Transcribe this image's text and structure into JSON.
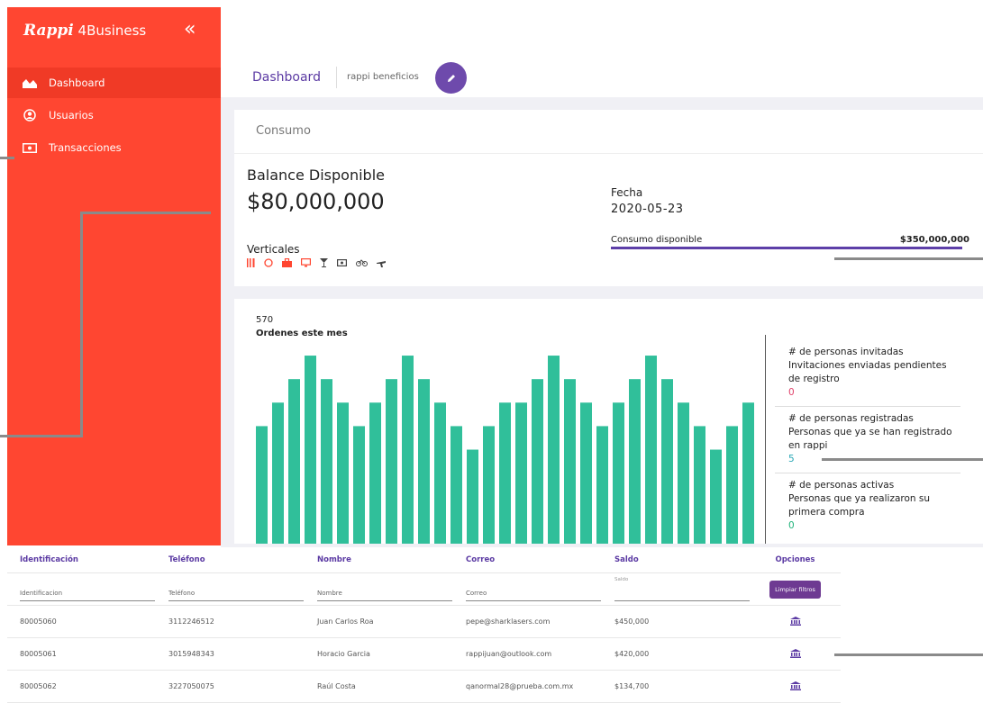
{
  "app": {
    "brand_name": "Rappi",
    "brand_suffix": "4Business",
    "collapse_icon": "double-chevron-left-icon"
  },
  "colors": {
    "sidebar": "#ff4631",
    "accent": "#5b3aa3",
    "bar": "#30bf9a",
    "pink": "#e0426a",
    "teal": "#2aa7b5",
    "green": "#21b37a"
  },
  "sidebar": {
    "items": [
      {
        "label": "Dashboard",
        "icon": "area-chart-icon",
        "active": true
      },
      {
        "label": "Usuarios",
        "icon": "user-circle-icon",
        "active": false
      },
      {
        "label": "Transacciones",
        "icon": "money-bill-icon",
        "active": false
      }
    ]
  },
  "header": {
    "title": "Dashboard",
    "subtitle": "rappi beneficios",
    "edit_icon": "pencil-icon"
  },
  "consumo": {
    "title": "Consumo",
    "balance_label": "Balance Disponible",
    "balance_value": "$80,000,000",
    "verticales_label": "Verticales",
    "vertical_icons": [
      "utensils-icon",
      "bubble-icon",
      "briefcase-icon",
      "monitor-icon",
      "cocktail-icon",
      "money-bill-icon",
      "bicycle-icon",
      "plane-icon"
    ],
    "fecha_label": "Fecha",
    "fecha_value": "2020-05-23",
    "consumo_label": "Consumo disponible",
    "consumo_value": "$350,000,000",
    "consumo_fill": 0.98
  },
  "orders": {
    "count": "570",
    "label": "Ordenes este mes"
  },
  "chart_data": {
    "type": "bar",
    "values": [
      5,
      6,
      7,
      8,
      7,
      6,
      5,
      6,
      7,
      8,
      7,
      6,
      5,
      4,
      5,
      6,
      6,
      7,
      8,
      7,
      6,
      5,
      6,
      7,
      8,
      7,
      6,
      5,
      4,
      5,
      6
    ],
    "ylim": [
      0,
      8.5
    ]
  },
  "stats": [
    {
      "title": "# de personas invitadas",
      "desc": "Invitaciones enviadas pendientes de registro",
      "value": "0"
    },
    {
      "title": "# de personas registradas",
      "desc": "Personas que ya se han registrado en rappi",
      "value": "5"
    },
    {
      "title": "# de personas activas",
      "desc": "Personas que ya realizaron su primera compra",
      "value": "0"
    }
  ],
  "table": {
    "headers": [
      "Identificación",
      "Teléfono",
      "Nombre",
      "Correo",
      "Saldo",
      "Opciones"
    ],
    "filters": {
      "id": "Identificacion",
      "phone": "Teléfono",
      "name": "Nombre",
      "email": "Correo",
      "saldo_small": "Saldo",
      "clear_button": "Limpiar filtros"
    },
    "rows": [
      {
        "id": "80005060",
        "phone": "3112246512",
        "name": "Juan Carlos Roa",
        "email": "pepe@sharklasers.com",
        "saldo": "$450,000",
        "action_icon": "bank-icon"
      },
      {
        "id": "80005061",
        "phone": "3015948343",
        "name": "Horacio Garcia",
        "email": "rappijuan@outlook.com",
        "saldo": "$420,000",
        "action_icon": "bank-icon"
      },
      {
        "id": "80005062",
        "phone": "3227050075",
        "name": "Raúl Costa",
        "email": "qanormal28@prueba.com.mx",
        "saldo": "$134,700",
        "action_icon": "bank-icon"
      }
    ]
  }
}
